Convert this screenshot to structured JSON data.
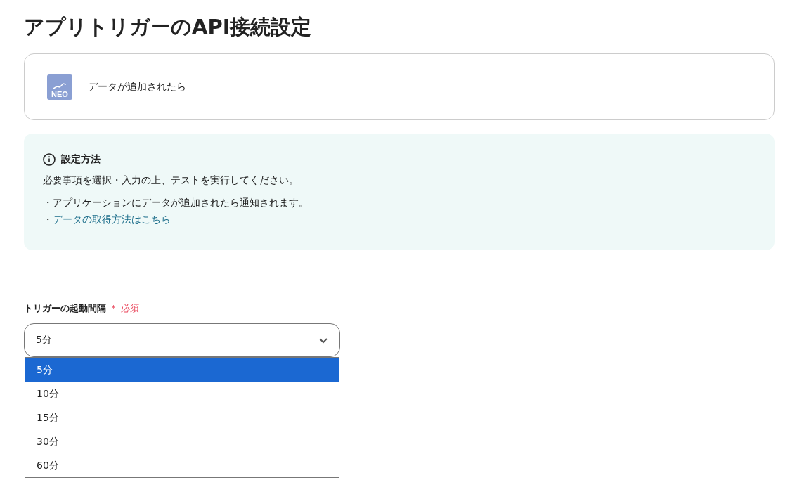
{
  "title": "アプリトリガーのAPI接続設定",
  "trigger": {
    "app_logo_text": "NEO",
    "label": "データが追加されたら"
  },
  "info": {
    "heading": "設定方法",
    "text": "必要事項を選択・入力の上、テストを実行してください。",
    "bullets": [
      {
        "kind": "text",
        "text": "・アプリケーションにデータが追加されたら通知されます。"
      },
      {
        "kind": "link",
        "prefix": "・",
        "text": "データの取得方法はこちら"
      }
    ]
  },
  "interval": {
    "label": "トリガーの起動間隔",
    "required_mark": "＊ 必須",
    "value": "5分",
    "expanded": true,
    "options": [
      {
        "label": "5分",
        "selected": true
      },
      {
        "label": "10分",
        "selected": false
      },
      {
        "label": "15分",
        "selected": false
      },
      {
        "label": "30分",
        "selected": false
      },
      {
        "label": "60分",
        "selected": false
      }
    ]
  }
}
